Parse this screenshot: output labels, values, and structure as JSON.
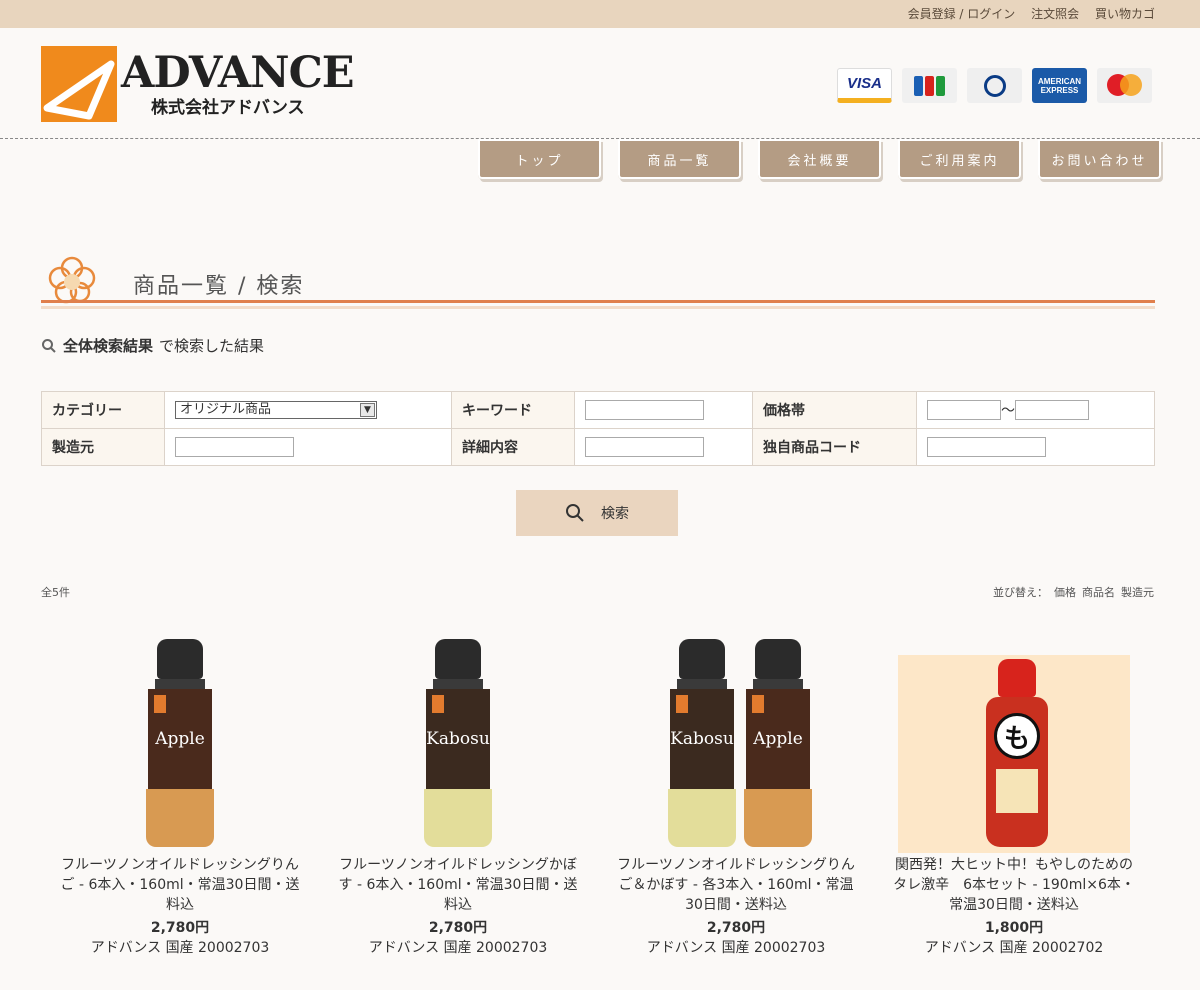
{
  "topbar": {
    "register": "会員登録",
    "separator": "/",
    "login": "ログイン",
    "orders": "注文照会",
    "cart": "買い物カゴ"
  },
  "logo": {
    "name_en": "ADVANCE",
    "name_jp": "株式会社アドバンス"
  },
  "payment_cards": [
    "VISA",
    "JCB",
    "Diners Club",
    "AMERICAN EXPRESS",
    "MasterCard"
  ],
  "nav": {
    "items": [
      {
        "label": "トップ"
      },
      {
        "label": "商品一覧"
      },
      {
        "label": "会社概要"
      },
      {
        "label": "ご利用案内"
      },
      {
        "label": "お問い合わせ"
      }
    ]
  },
  "section": {
    "title": "商品一覧 / 検索"
  },
  "result": {
    "query": "全体検索結果",
    "suffix": "で検索した結果"
  },
  "search_form": {
    "category_label": "カテゴリー",
    "category_value": "オリジナル商品",
    "keyword_label": "キーワード",
    "price_label": "価格帯",
    "price_sep": "～",
    "maker_label": "製造元",
    "detail_label": "詳細内容",
    "code_label": "独自商品コード",
    "submit_label": "検索"
  },
  "listing": {
    "count": "全5件",
    "sort_label": "並び替え：",
    "sort_price": "価格",
    "sort_name": "商品名",
    "sort_maker": "製造元"
  },
  "products": [
    {
      "name": "フルーツノンオイルドレッシングりんご - 6本入・160ml・常温30日間・送料込",
      "price": "2,780円",
      "meta": "アドバンス 国産 20002703",
      "image": "apple-dressing"
    },
    {
      "name": "フルーツノンオイルドレッシングかぼす - 6本入・160ml・常温30日間・送料込",
      "price": "2,780円",
      "meta": "アドバンス 国産 20002703",
      "image": "kabosu-dressing"
    },
    {
      "name": "フルーツノンオイルドレッシングりんご＆かぼす - 各3本入・160ml・常温30日間・送料込",
      "price": "2,780円",
      "meta": "アドバンス 国産 20002703",
      "image": "kabosu-apple-dressing"
    },
    {
      "name": "関西発！大ヒット中！もやしのためのタレ激辛　6本セット - 190ml×6本・常温30日間・送料込",
      "price": "1,800円",
      "meta": "アドバンス 国産 20002702",
      "image": "moyashi-sauce"
    }
  ],
  "product_labels": {
    "apple": "Apple",
    "kabosu": "Kabosu",
    "mo": "も"
  },
  "colors": {
    "accent": "#e07f4c",
    "topbar": "#e8d5be",
    "nav": "#b49c84",
    "button": "#ead5bf"
  }
}
